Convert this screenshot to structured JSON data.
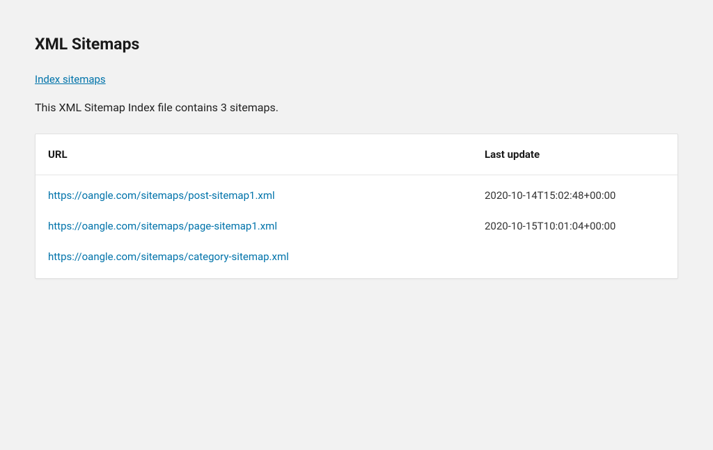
{
  "heading": "XML Sitemaps",
  "index_link_text": "Index sitemaps",
  "description": "This XML Sitemap Index file contains 3 sitemaps.",
  "columns": {
    "url": "URL",
    "last_update": "Last update"
  },
  "rows": [
    {
      "url": "https://oangle.com/sitemaps/post-sitemap1.xml",
      "last_update": "2020-10-14T15:02:48+00:00"
    },
    {
      "url": "https://oangle.com/sitemaps/page-sitemap1.xml",
      "last_update": "2020-10-15T10:01:04+00:00"
    },
    {
      "url": "https://oangle.com/sitemaps/category-sitemap.xml",
      "last_update": ""
    }
  ]
}
